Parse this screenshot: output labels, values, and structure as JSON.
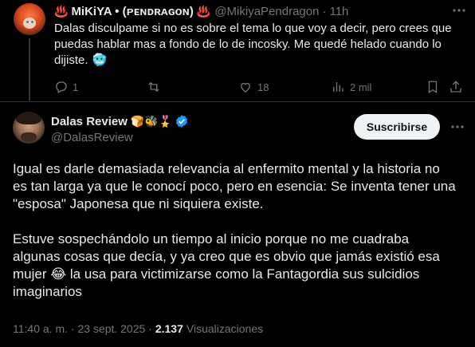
{
  "reply": {
    "display_name": "MiKiYA • (ᴘᴇɴᴅʀᴀɢᴏɴ)",
    "name_emoji_left": "♨️",
    "name_emoji_right": "♨️",
    "handle": "@MikiyaPendragon",
    "separator": "·",
    "time": "11h",
    "text_lines": [
      "Dalas disculpame si no es sobre el tema lo que voy a decir, pero crees que",
      "puedas hablar mas a fondo de lo de incosky. Me quedé helado cuando lo",
      "dijiste."
    ],
    "text_emoji": "🥶",
    "replies_count": "1",
    "retweets_count": "",
    "likes_count": "18",
    "views_count": "2 mil"
  },
  "main": {
    "display_name": "Dalas Review",
    "name_emojis": "🍞🐝🎖️",
    "handle": "@DalasReview",
    "subscribe_label": "Suscribirse",
    "paragraph1_lines": [
      "Igual es darle demasiada relevancia al enfermito mental y la historia no",
      "es tan larga ya que le conocí poco, pero en esencia: Se inventa tener una",
      "\"esposa\" Japonesa que ni siquiera existe."
    ],
    "paragraph2_lines": [
      "Estuve sospechándolo un tiempo al inicio porque no me cuadraba",
      "algunas cosas que decía, y ya creo que es obvio que jamás existió esa"
    ],
    "paragraph2_line3_before": "mujer",
    "paragraph2_line3_emoji": "😂",
    "paragraph2_line3_after": "la usa para victimizarse como la Fantagordia sus sulcidios",
    "paragraph2_line4": "imaginarios",
    "timestamp": "11:40 a. m. · 23 sept. 2025 ·",
    "views_number": "2.137",
    "views_label": "Visualizaciones"
  },
  "colors": {
    "background": "#000000",
    "text": "#e7e9ea",
    "muted": "#71767b",
    "verified": "#1d9bf0",
    "divider": "#2f3336"
  }
}
